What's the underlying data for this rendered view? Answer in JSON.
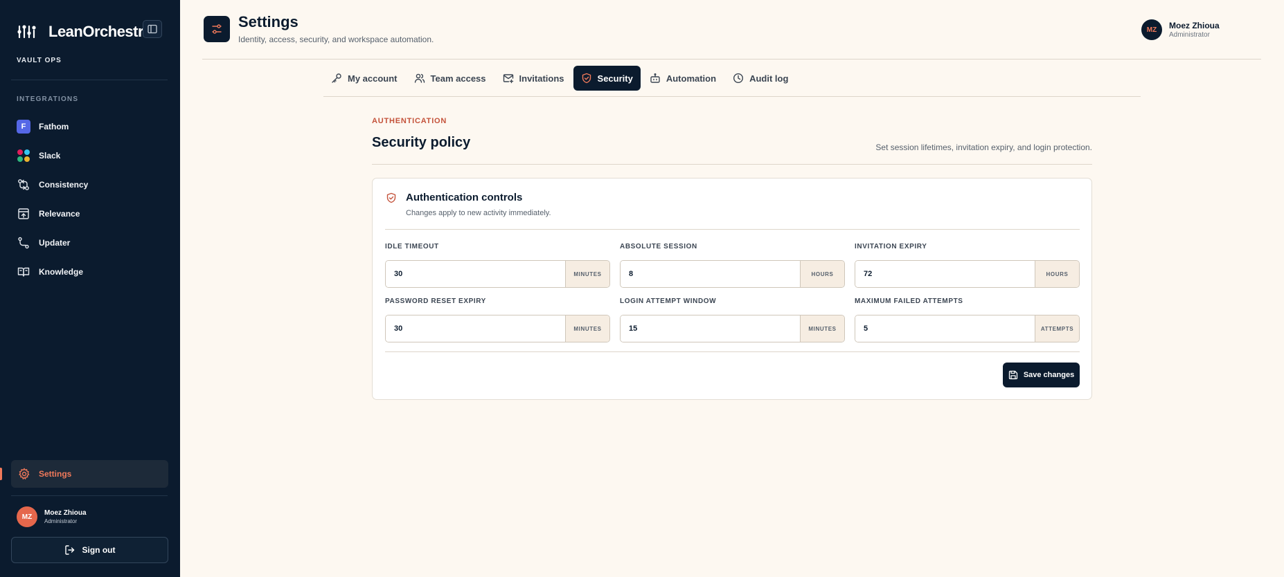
{
  "brand": {
    "name": "LeanOrchestr"
  },
  "workspace": {
    "label": "VAULT OPS"
  },
  "sidebar": {
    "section_label": "INTEGRATIONS",
    "items": [
      {
        "label": "Fathom",
        "icon": "fathom-badge",
        "badge": "F"
      },
      {
        "label": "Slack",
        "icon": "slack-icon"
      },
      {
        "label": "Consistency",
        "icon": "git-compare-icon"
      },
      {
        "label": "Relevance",
        "icon": "upload-box-icon"
      },
      {
        "label": "Updater",
        "icon": "route-icon"
      },
      {
        "label": "Knowledge",
        "icon": "book-open-icon"
      }
    ],
    "settings_label": "Settings",
    "user": {
      "initials": "MZ",
      "name": "Moez Zhioua",
      "role": "Administrator"
    },
    "sign_out_label": "Sign out"
  },
  "header": {
    "title": "Settings",
    "subtitle": "Identity, access, security, and workspace automation.",
    "user": {
      "initials": "MZ",
      "name": "Moez Zhioua",
      "role": "Administrator"
    }
  },
  "tabs": [
    {
      "label": "My account",
      "icon": "key-icon",
      "active": false
    },
    {
      "label": "Team access",
      "icon": "users-icon",
      "active": false
    },
    {
      "label": "Invitations",
      "icon": "mail-plus-icon",
      "active": false
    },
    {
      "label": "Security",
      "icon": "shield-check-icon",
      "active": true
    },
    {
      "label": "Automation",
      "icon": "bot-icon",
      "active": false
    },
    {
      "label": "Audit log",
      "icon": "clock-icon",
      "active": false
    }
  ],
  "section": {
    "eyebrow": "AUTHENTICATION",
    "title": "Security policy",
    "description": "Set session lifetimes, invitation expiry, and login protection."
  },
  "card": {
    "title": "Authentication controls",
    "subtitle": "Changes apply to new activity immediately.",
    "fields": [
      {
        "label": "IDLE TIMEOUT",
        "value": "30",
        "unit": "MINUTES"
      },
      {
        "label": "ABSOLUTE SESSION",
        "value": "8",
        "unit": "HOURS"
      },
      {
        "label": "INVITATION EXPIRY",
        "value": "72",
        "unit": "HOURS"
      },
      {
        "label": "PASSWORD RESET EXPIRY",
        "value": "30",
        "unit": "MINUTES"
      },
      {
        "label": "LOGIN ATTEMPT WINDOW",
        "value": "15",
        "unit": "MINUTES"
      },
      {
        "label": "MAXIMUM FAILED ATTEMPTS",
        "value": "5",
        "unit": "ATTEMPTS"
      }
    ],
    "save_label": "Save changes"
  },
  "colors": {
    "sidebar_bg": "#0b1b2e",
    "page_bg": "#fdf8f1",
    "accent": "#f0795a",
    "eyebrow": "#c4523a",
    "fathom": "#5567e6"
  }
}
